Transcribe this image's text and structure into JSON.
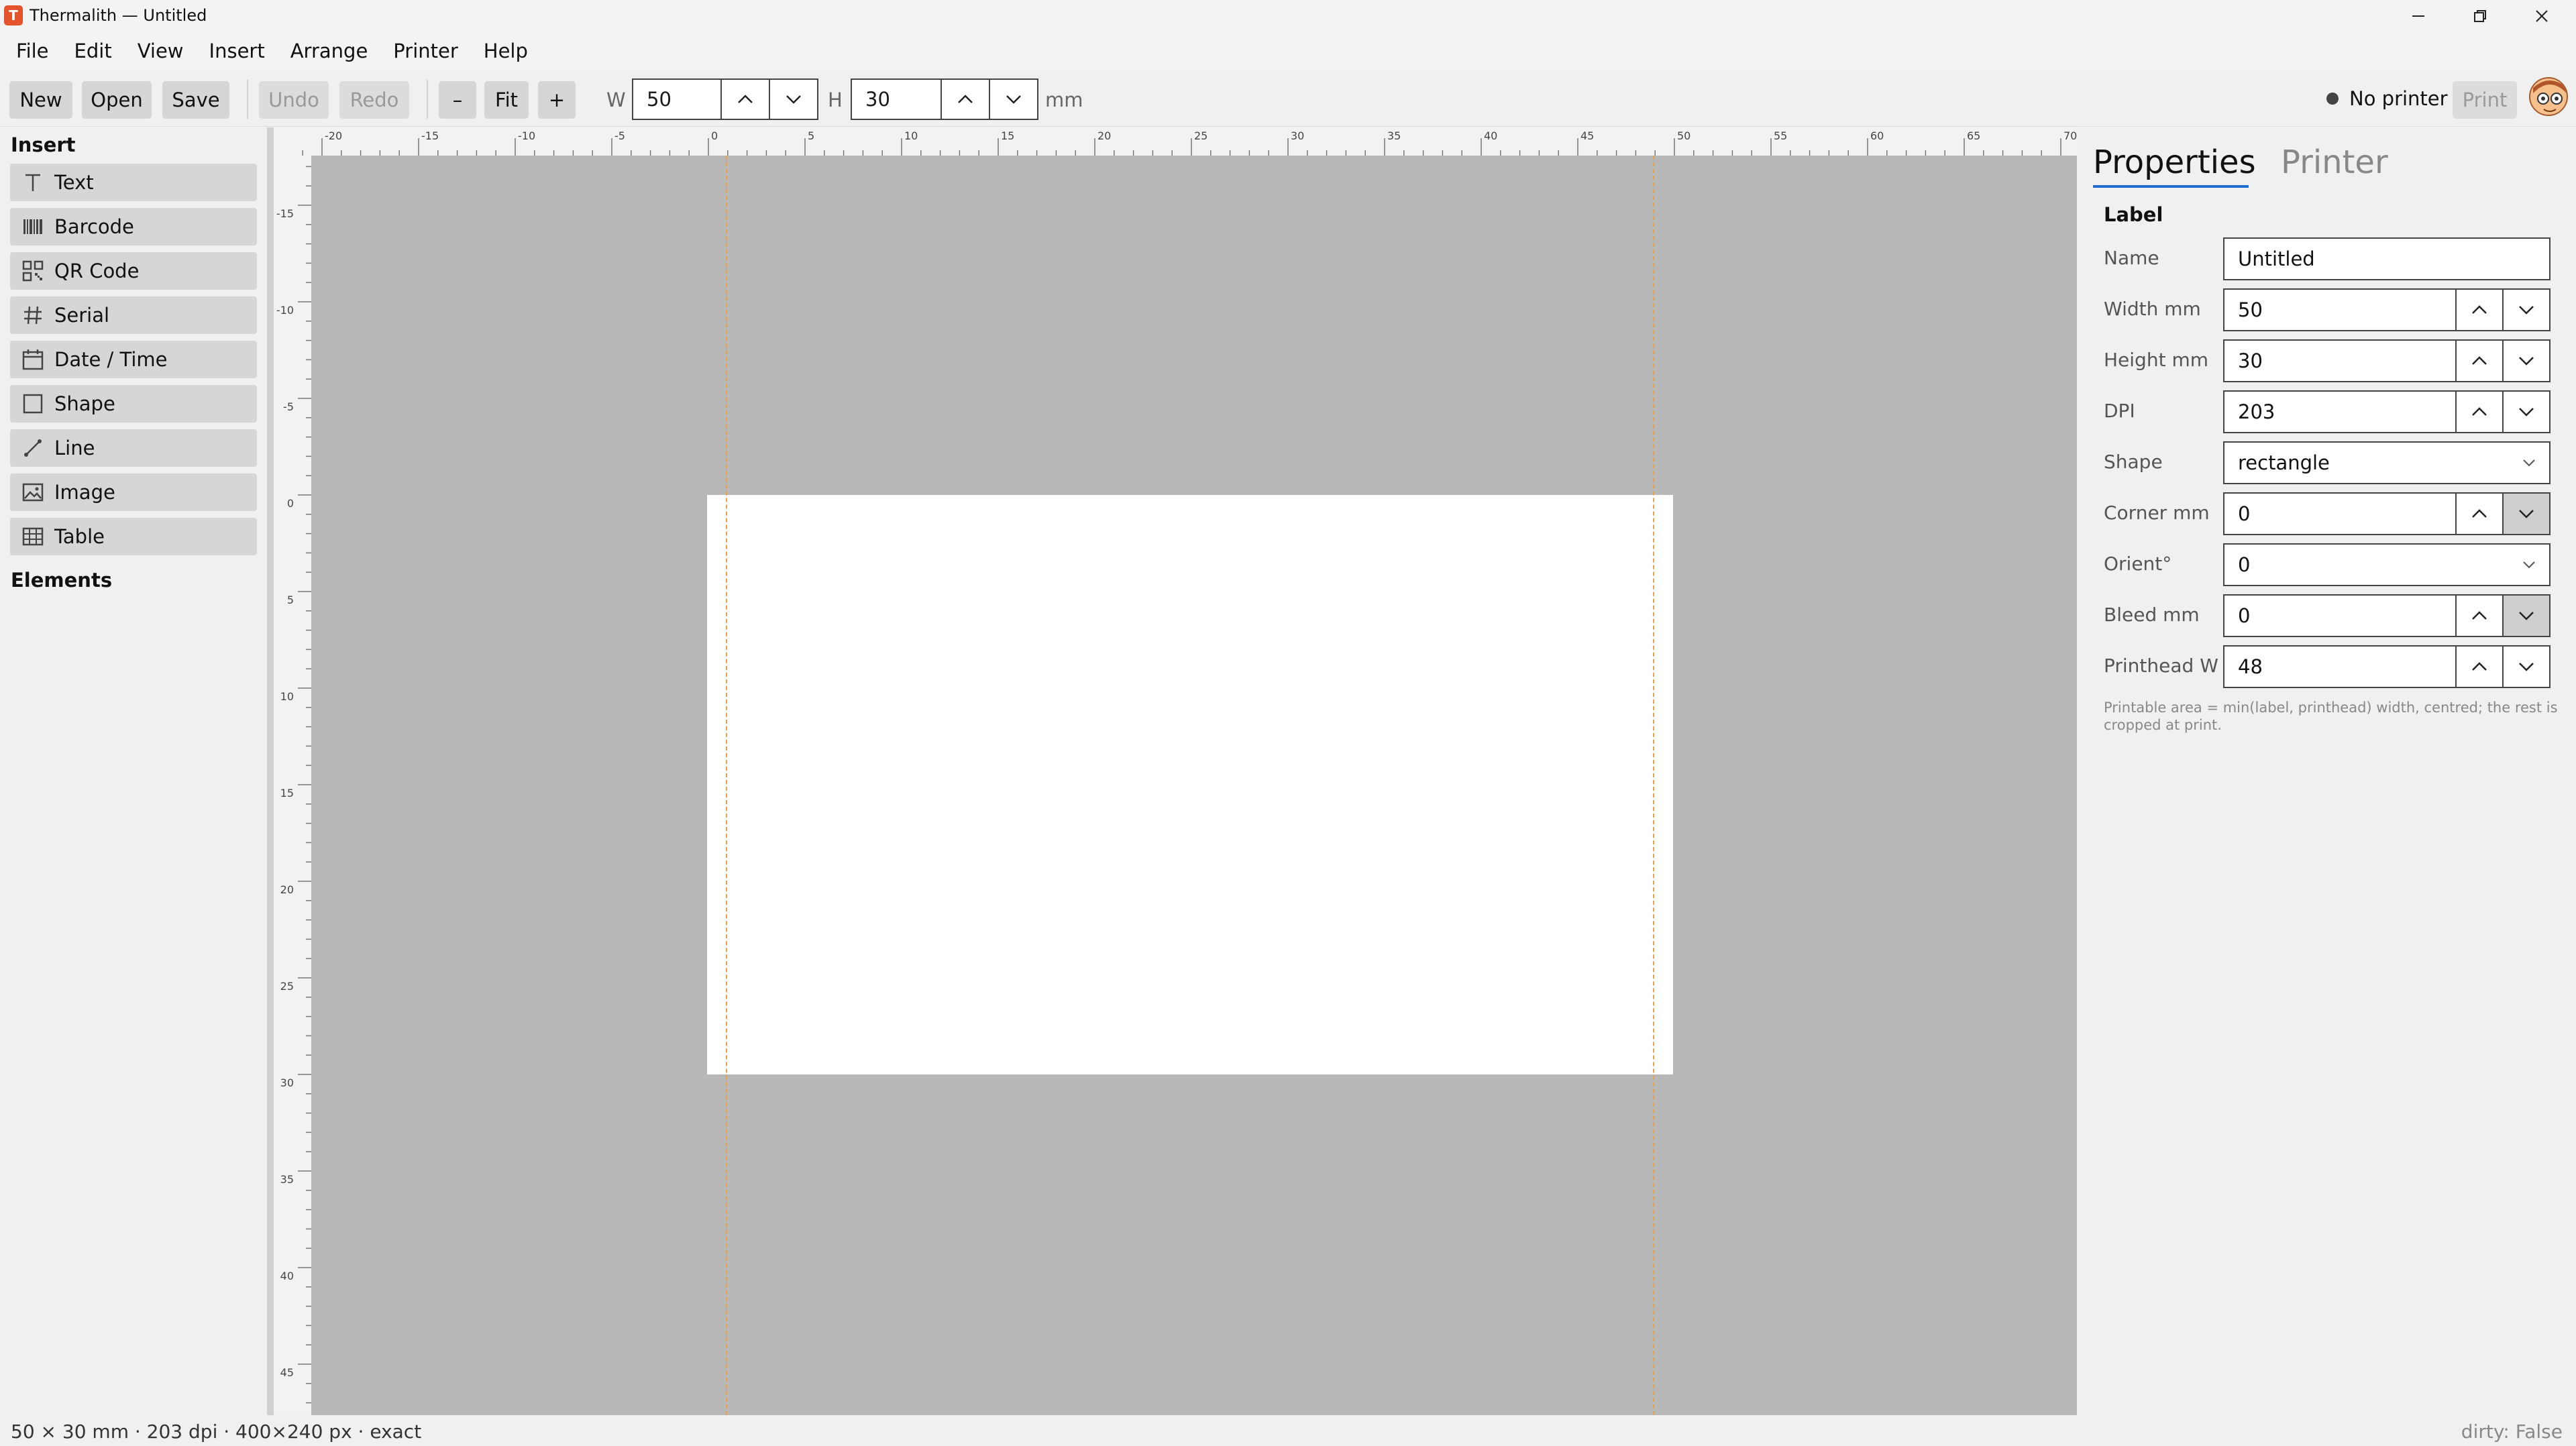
{
  "window": {
    "title": "Thermalith — Untitled",
    "app_icon_letter": "T"
  },
  "menu": [
    "File",
    "Edit",
    "View",
    "Insert",
    "Arrange",
    "Printer",
    "Help"
  ],
  "toolbar": {
    "new": "New",
    "open": "Open",
    "save": "Save",
    "undo": "Undo",
    "redo": "Redo",
    "zoom_out": "–",
    "fit": "Fit",
    "zoom_in": "+",
    "w_label": "W",
    "w_value": "50",
    "h_label": "H",
    "h_value": "30",
    "unit": "mm",
    "printer_status": "No printer",
    "print": "Print"
  },
  "left": {
    "insert_heading": "Insert",
    "insert_items": [
      {
        "label": "Text",
        "icon": "text-icon"
      },
      {
        "label": "Barcode",
        "icon": "barcode-icon"
      },
      {
        "label": "QR Code",
        "icon": "qr-code-icon"
      },
      {
        "label": "Serial",
        "icon": "hash-icon"
      },
      {
        "label": "Date / Time",
        "icon": "calendar-icon"
      },
      {
        "label": "Shape",
        "icon": "square-icon"
      },
      {
        "label": "Line",
        "icon": "line-icon"
      },
      {
        "label": "Image",
        "icon": "image-icon"
      },
      {
        "label": "Table",
        "icon": "table-icon"
      }
    ],
    "elements_heading": "Elements"
  },
  "rulers": {
    "horizontal": [
      "-20",
      "-15",
      "-10",
      "-5",
      "0",
      "5",
      "10",
      "15",
      "20",
      "25",
      "30",
      "35",
      "40",
      "45",
      "50",
      "55",
      "60",
      "65",
      "70"
    ],
    "vertical": [
      "-15",
      "-10",
      "-5",
      "0",
      "5",
      "10",
      "15",
      "20",
      "25",
      "30",
      "35",
      "40",
      "45"
    ]
  },
  "label_canvas": {
    "width_mm": 50,
    "height_mm": 30,
    "printable_width_mm": 48
  },
  "right": {
    "tabs": [
      "Properties",
      "Printer"
    ],
    "active_tab": "Properties",
    "section": "Label",
    "fields": [
      {
        "label": "Name",
        "value": "Untitled",
        "kind": "text"
      },
      {
        "label": "Width mm",
        "value": "50",
        "kind": "spin"
      },
      {
        "label": "Height mm",
        "value": "30",
        "kind": "spin"
      },
      {
        "label": "DPI",
        "value": "203",
        "kind": "spin"
      },
      {
        "label": "Shape",
        "value": "rectangle",
        "kind": "select"
      },
      {
        "label": "Corner mm",
        "value": "0",
        "kind": "spin"
      },
      {
        "label": "Orient°",
        "value": "0",
        "kind": "select"
      },
      {
        "label": "Bleed mm",
        "value": "0",
        "kind": "spin"
      },
      {
        "label": "Printhead W",
        "value": "48",
        "kind": "spin"
      }
    ],
    "hint": "Printable area = min(label, printhead) width, centred; the rest is cropped at print."
  },
  "status": {
    "left": "50 × 30 mm · 203 dpi · 400×240 px · exact",
    "right": "dirty: False"
  }
}
